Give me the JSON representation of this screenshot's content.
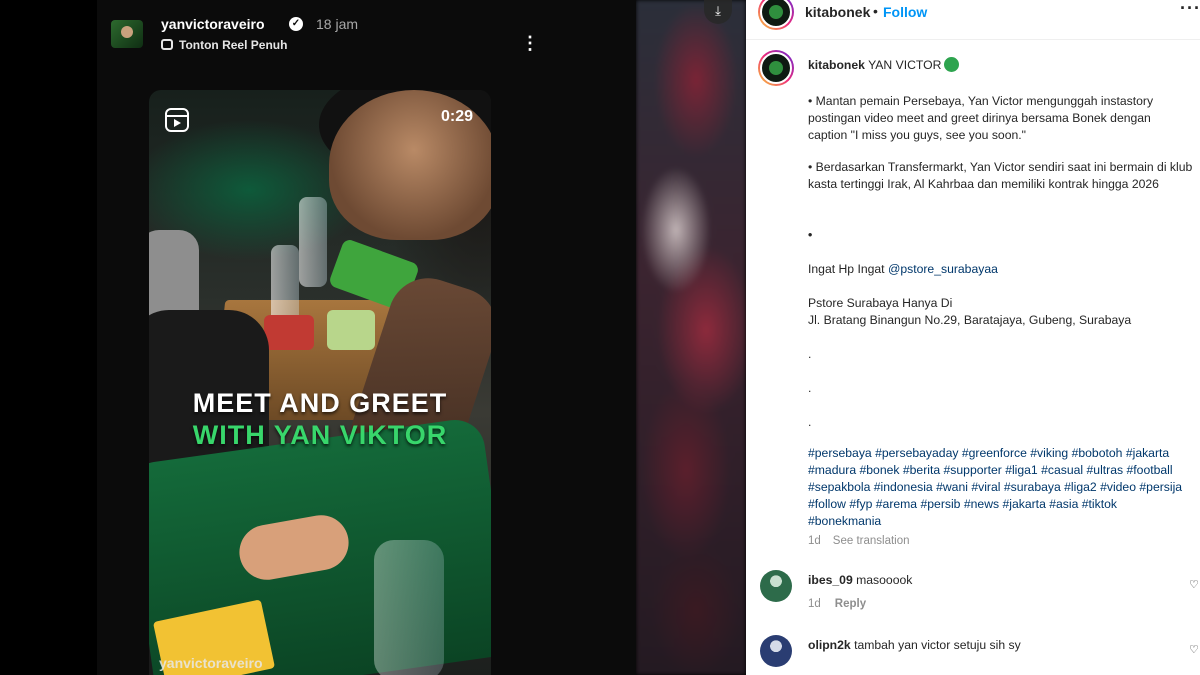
{
  "story": {
    "username": "yanvictoraveiro",
    "time": "18 jam",
    "subtitle": "Tonton Reel Penuh",
    "more_label": "⋮",
    "duration": "0:29",
    "overlay_line1": "MEET AND GREET",
    "overlay_line2": "WITH YAN VIKTOR",
    "watermark": "yanvictoraveiro",
    "icons": [
      "verified-badge-icon",
      "reel-icon",
      "download-icon"
    ]
  },
  "post": {
    "header": {
      "username": "kitabonek",
      "dot": "•",
      "follow_label": "Follow",
      "more_label": "···"
    },
    "caption": {
      "username": "kitabonek",
      "title": "YAN VICTOR",
      "paragraph1": "• Mantan pemain Persebaya, Yan Victor mengunggah instastory postingan video meet and greet dirinya bersama Bonek dengan caption \"I miss you guys, see you soon.\"",
      "paragraph2": "• Berdasarkan Transfermarkt, Yan Victor sendiri saat ini bermain di klub kasta tertinggi Irak, Al Kahrbaa dan memiliki kontrak hingga 2026",
      "bullet": "•",
      "ingat_prefix": "Ingat Hp Ingat ",
      "ingat_mention": "@pstore_surabayaa",
      "store_line1": "Pstore Surabaya Hanya Di",
      "store_line2": "Jl. Bratang Binangun No.29, Baratajaya, Gubeng, Surabaya",
      "dots": [
        ".",
        ".",
        "."
      ],
      "hashtags": [
        "#persebaya",
        "#persebayaday",
        "#greenforce",
        "#viking",
        "#bobotoh",
        "#jakarta",
        "#madura",
        "#bonek",
        "#berita",
        "#supporter",
        "#liga1",
        "#casual",
        "#ultras",
        "#football",
        "#sepakbola",
        "#indonesia",
        "#wani",
        "#viral",
        "#surabaya",
        "#liga2",
        "#video",
        "#persija",
        "#follow",
        "#fyp",
        "#arema",
        "#persib",
        "#news",
        "#jakarta",
        "#asia",
        "#tiktok",
        "#bonekmania"
      ],
      "age": "1d",
      "see_translation": "See translation"
    },
    "comments": [
      {
        "username": "ibes_09",
        "text": "masooook",
        "age": "1d",
        "reply_label": "Reply"
      },
      {
        "username": "olipn2k",
        "text": "tambah yan victor setuju sih sy",
        "age": "",
        "reply_label": ""
      }
    ]
  }
}
